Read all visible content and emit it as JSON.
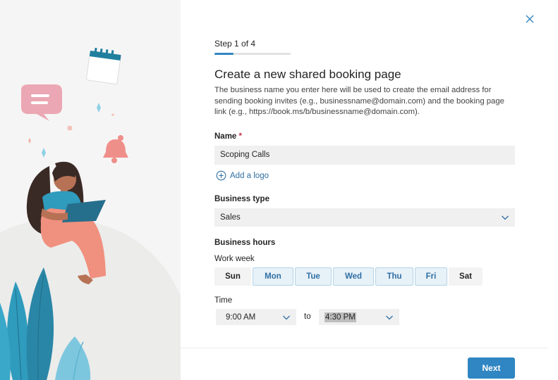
{
  "wizard": {
    "step_label": "Step 1 of 4",
    "progress_fraction": 0.25,
    "title": "Create a new shared booking page",
    "description": "The business name you enter here will be used to create the email address for sending booking invites (e.g., businessname@domain.com) and the booking page link (e.g., https://book.ms/b/businessname@domain.com)."
  },
  "form": {
    "name_label": "Name",
    "required_marker": "*",
    "name_value": "Scoping Calls",
    "add_logo_label": "Add a logo",
    "business_type_label": "Business type",
    "business_type_value": "Sales",
    "business_hours_label": "Business hours",
    "work_week_label": "Work week",
    "days": [
      {
        "label": "Sun",
        "selected": false
      },
      {
        "label": "Mon",
        "selected": true
      },
      {
        "label": "Tue",
        "selected": true
      },
      {
        "label": "Wed",
        "selected": true
      },
      {
        "label": "Thu",
        "selected": true
      },
      {
        "label": "Fri",
        "selected": true
      },
      {
        "label": "Sat",
        "selected": false
      }
    ],
    "time_label": "Time",
    "start_time": "9:00 AM",
    "to_label": "to",
    "end_time": "4:30 PM"
  },
  "footer": {
    "next_label": "Next"
  },
  "icons": {
    "close": "close-icon",
    "add": "add-circle-icon",
    "chevron": "chevron-down-icon"
  },
  "colors": {
    "accent": "#2f86c2",
    "link": "#2f6fa3",
    "required": "#c4314b",
    "selected_day_bg": "#e7f1f8",
    "selected_day_border": "#b6d3e8"
  }
}
